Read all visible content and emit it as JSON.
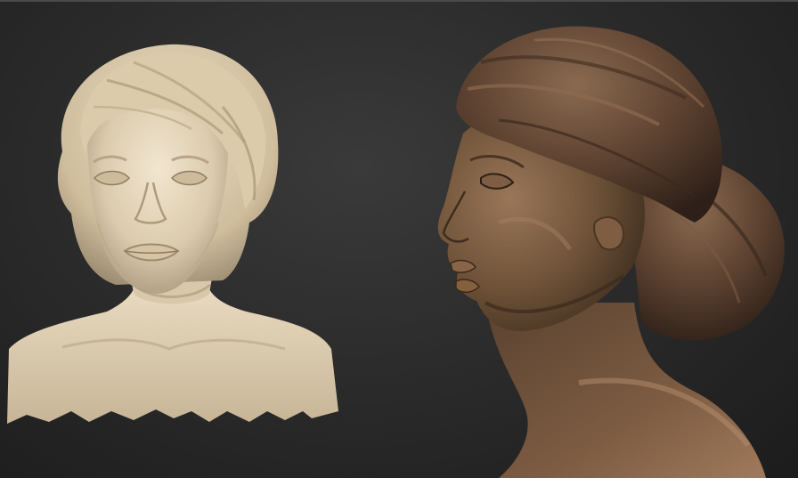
{
  "scene": {
    "description_hidden": "",
    "background": "#2c2c2c",
    "models": [
      {
        "name": "front-bust",
        "material_color": "#e2d2b6",
        "shadow_color": "#a8977c",
        "highlight_color": "#f3e8d4"
      },
      {
        "name": "profile-bust",
        "material_color": "#6e5238",
        "shadow_color": "#3a2a1c",
        "highlight_color": "#a07a58",
        "hair_color": "#5a3f2b"
      }
    ]
  }
}
